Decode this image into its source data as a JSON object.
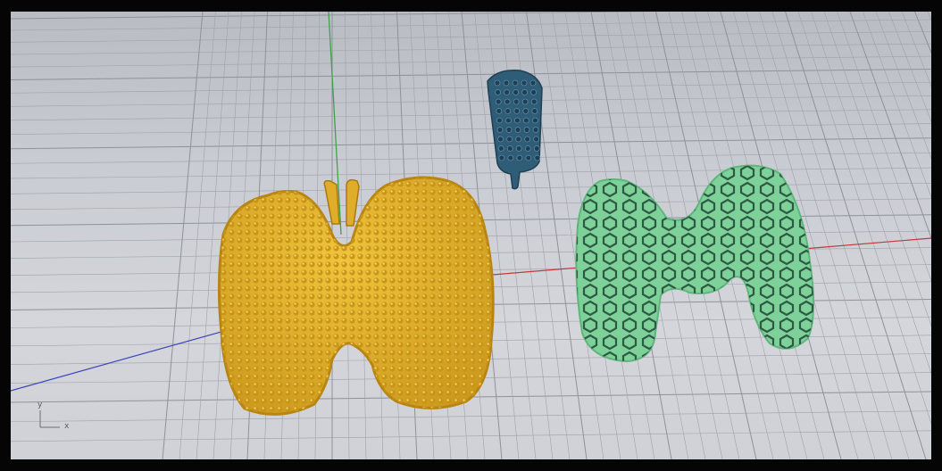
{
  "viewport": {
    "name": "perspective-viewport",
    "background": "#c9ccd2",
    "grid_color": "#9ea2a9",
    "major_grid_color": "#8e9299"
  },
  "axes": {
    "x_color": "#c0393a",
    "y_color": "#3fa14a",
    "z_color": "#3b46b8"
  },
  "axis_widget": {
    "x_label": "x",
    "y_label": "y"
  },
  "objects": [
    {
      "name": "textured-pendant",
      "color": "#e0ad2a"
    },
    {
      "name": "pendant-bail",
      "color": "#2f5d78"
    },
    {
      "name": "lattice-pendant",
      "color": "#7fd19a"
    }
  ]
}
